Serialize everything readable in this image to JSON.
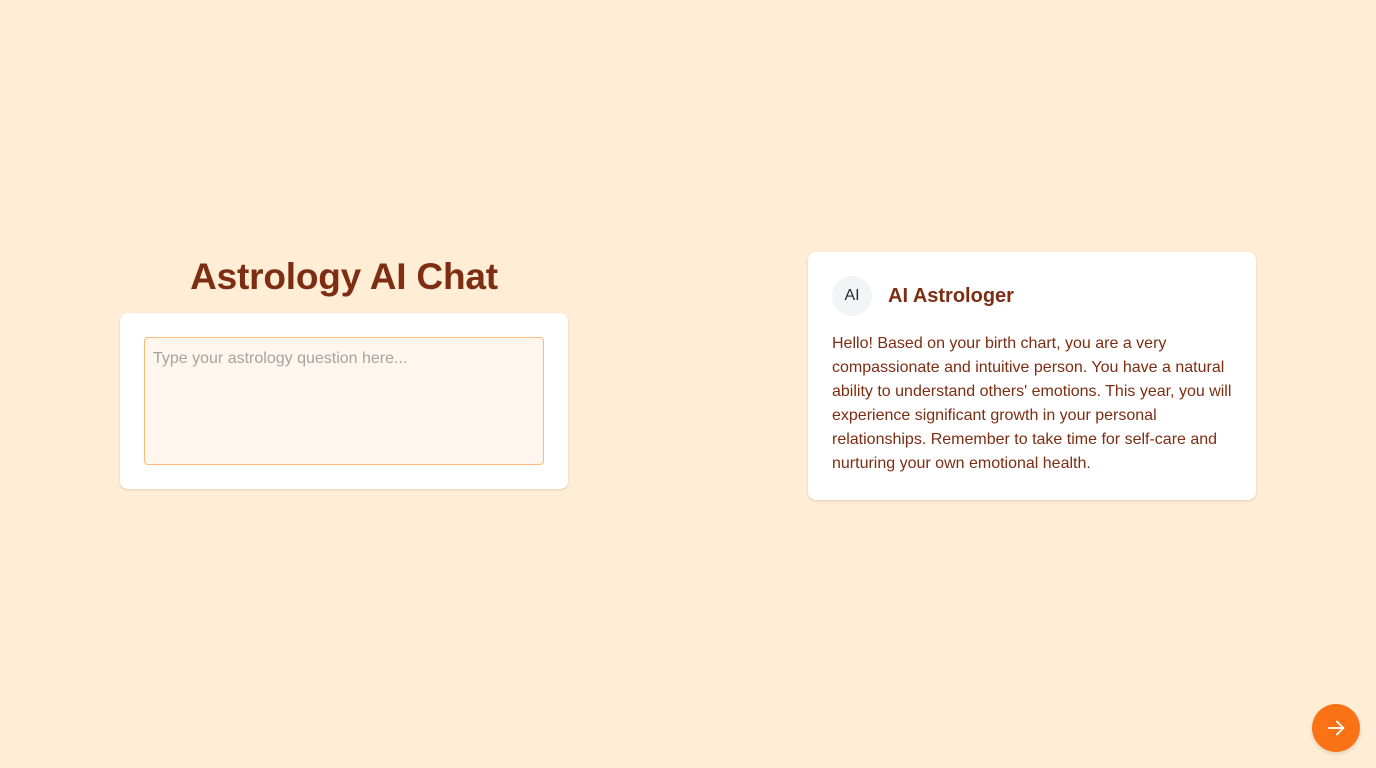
{
  "app": {
    "title": "Astrology AI Chat"
  },
  "input": {
    "placeholder": "Type your astrology question here...",
    "value": ""
  },
  "response": {
    "avatar_text": "AI",
    "sender": "AI Astrologer",
    "message": "Hello! Based on your birth chart, you are a very compassionate and intuitive person. You have a natural ability to understand others' emotions. This year, you will experience significant growth in your personal relationships. Remember to take time for self-care and nurturing your own emotional health."
  },
  "send_button": {
    "icon": "arrow-right-icon"
  },
  "colors": {
    "background": "#ffedd5",
    "title": "#7c2d12",
    "accent": "#f97316",
    "input_border": "#fdba74",
    "input_background": "#fff7ed"
  }
}
